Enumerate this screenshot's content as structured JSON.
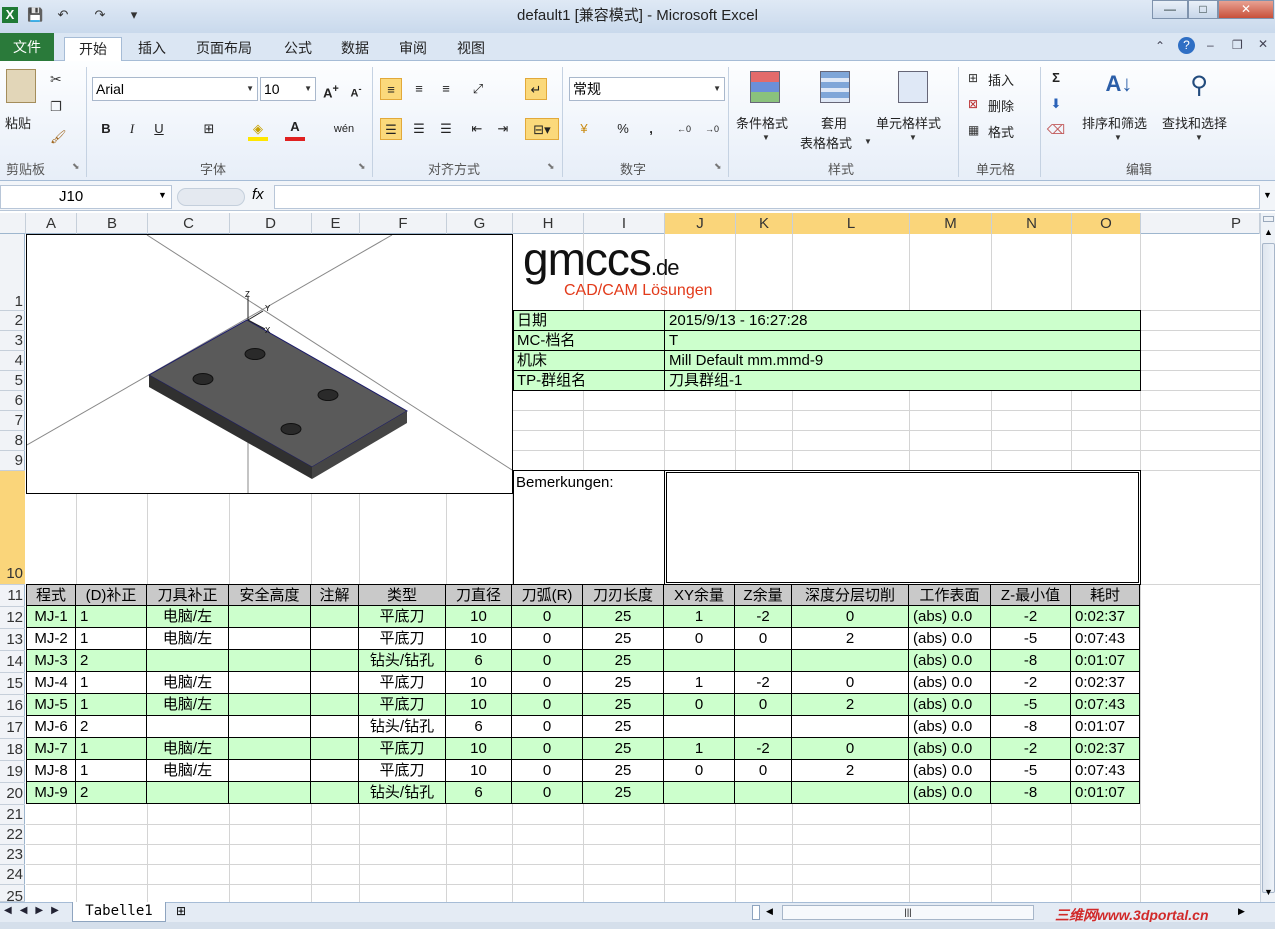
{
  "window": {
    "title": "default1  [兼容模式] - Microsoft Excel",
    "min": "—",
    "max": "□",
    "close": "✕"
  },
  "tabs": [
    "文件",
    "开始",
    "插入",
    "页面布局",
    "公式",
    "数据",
    "审阅",
    "视图"
  ],
  "ribbon": {
    "clipboard": {
      "paste": "粘贴",
      "label": "剪贴板"
    },
    "font": {
      "name": "Arial",
      "size": "10",
      "label": "字体"
    },
    "align": {
      "label": "对齐方式"
    },
    "number": {
      "format": "常规",
      "label": "数字",
      "percent": "%",
      "comma": ","
    },
    "styles": {
      "cond": "条件格式",
      "table1": "套用",
      "table2": "表格格式",
      "cell": "单元格样式",
      "label": "样式"
    },
    "cells": {
      "insert": "插入",
      "delete": "删除",
      "format": "格式",
      "label": "单元格"
    },
    "edit": {
      "sum": "Σ",
      "sort": "排序和筛选",
      "find": "查找和选择",
      "label": "编辑"
    }
  },
  "formula_bar": {
    "name_box": "J10",
    "fx": "fx",
    "content": ""
  },
  "columns": [
    "A",
    "B",
    "C",
    "D",
    "E",
    "F",
    "G",
    "H",
    "I",
    "J",
    "K",
    "L",
    "M",
    "N",
    "O",
    "P"
  ],
  "rows": [
    "1",
    "2",
    "3",
    "4",
    "5",
    "6",
    "7",
    "8",
    "9",
    "10",
    "11",
    "12",
    "13",
    "14",
    "15",
    "16",
    "17",
    "18",
    "19",
    "20",
    "21",
    "22",
    "23",
    "24",
    "25"
  ],
  "logo": {
    "main": "gmccs",
    "suffix": ".de",
    "sub": "CAD/CAM Lösungen"
  },
  "info": [
    {
      "label": "日期",
      "value": "2015/9/13 - 16:27:28"
    },
    {
      "label": "MC-档名",
      "value": "T"
    },
    {
      "label": "机床",
      "value": "Mill Default mm.mmd-9"
    },
    {
      "label": "TP-群组名",
      "value": "刀具群组-1"
    }
  ],
  "remarks_label": "Bemerkungen:",
  "table": {
    "headers": [
      "程式",
      "(D)补正",
      "刀具补正",
      "安全高度",
      "注解",
      "类型",
      "刀直径",
      "刀弧(R)",
      "刀刃长度",
      "XY余量",
      "Z余量",
      "深度分层切削",
      "工作表面",
      "Z-最小值",
      "耗时"
    ],
    "rows": [
      [
        "MJ-1",
        "1",
        "电脑/左",
        "",
        "",
        "平底刀",
        "10",
        "0",
        "25",
        "1",
        "-2",
        "0",
        "(abs) 0.0",
        "-2",
        "0:02:37"
      ],
      [
        "MJ-2",
        "1",
        "电脑/左",
        "",
        "",
        "平底刀",
        "10",
        "0",
        "25",
        "0",
        "0",
        "2",
        "(abs) 0.0",
        "-5",
        "0:07:43"
      ],
      [
        "MJ-3",
        "2",
        "",
        "",
        "",
        "钻头/钻孔",
        "6",
        "0",
        "25",
        "",
        "",
        "",
        "(abs) 0.0",
        "-8",
        "0:01:07"
      ],
      [
        "MJ-4",
        "1",
        "电脑/左",
        "",
        "",
        "平底刀",
        "10",
        "0",
        "25",
        "1",
        "-2",
        "0",
        "(abs) 0.0",
        "-2",
        "0:02:37"
      ],
      [
        "MJ-5",
        "1",
        "电脑/左",
        "",
        "",
        "平底刀",
        "10",
        "0",
        "25",
        "0",
        "0",
        "2",
        "(abs) 0.0",
        "-5",
        "0:07:43"
      ],
      [
        "MJ-6",
        "2",
        "",
        "",
        "",
        "钻头/钻孔",
        "6",
        "0",
        "25",
        "",
        "",
        "",
        "(abs) 0.0",
        "-8",
        "0:01:07"
      ],
      [
        "MJ-7",
        "1",
        "电脑/左",
        "",
        "",
        "平底刀",
        "10",
        "0",
        "25",
        "1",
        "-2",
        "0",
        "(abs) 0.0",
        "-2",
        "0:02:37"
      ],
      [
        "MJ-8",
        "1",
        "电脑/左",
        "",
        "",
        "平底刀",
        "10",
        "0",
        "25",
        "0",
        "0",
        "2",
        "(abs) 0.0",
        "-5",
        "0:07:43"
      ],
      [
        "MJ-9",
        "2",
        "",
        "",
        "",
        "钻头/钻孔",
        "6",
        "0",
        "25",
        "",
        "",
        "",
        "(abs) 0.0",
        "-8",
        "0:01:07"
      ]
    ]
  },
  "sheet_tab": "Tabelle1",
  "watermark": "三维网www.3dportal.cn",
  "colors": {
    "green": "#ccffcc",
    "file_tab": "#2a7a3a",
    "selected_header": "#fad57a"
  }
}
